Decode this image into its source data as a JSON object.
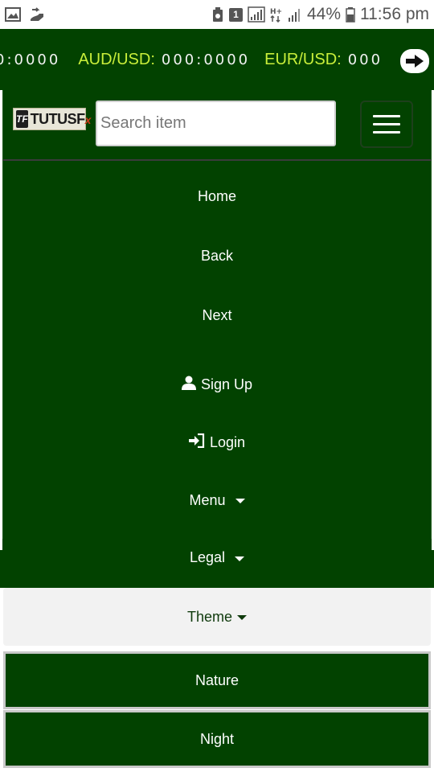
{
  "status_bar": {
    "icons_left": [
      "image-icon",
      "download-icon"
    ],
    "icons_right": [
      "recycle-icon",
      "sim-icon",
      "signal-icon",
      "network-type-icon",
      "signal-icon-2",
      "battery-icon"
    ],
    "sim_number": "1",
    "network_type": "H+",
    "battery": "44%",
    "time": "11:56 pm"
  },
  "ticker": {
    "items": [
      {
        "pair": "",
        "value": "0:0000"
      },
      {
        "pair": "AUD/USD:",
        "value": "000:0000"
      },
      {
        "pair": "EUR/USD:",
        "value": "000"
      }
    ],
    "arrow_icon": "arrow-right-icon"
  },
  "navbar": {
    "logo_text": "TUTUSF",
    "logo_suffix": "x",
    "logo_mark": "TF",
    "search_placeholder": "Search item",
    "menu_icon": "hamburger-icon"
  },
  "menu": {
    "home": "Home",
    "back": "Back",
    "next": "Next",
    "signup": "Sign Up",
    "login": "Login",
    "menu": "Menu",
    "legal": "Legal",
    "theme": "Theme"
  },
  "theme_options": [
    "Nature",
    "Night"
  ],
  "colors": {
    "brand_green": "#024200",
    "ticker_pair": "#c9ef3a",
    "theme_bg": "#f2f2f2"
  }
}
